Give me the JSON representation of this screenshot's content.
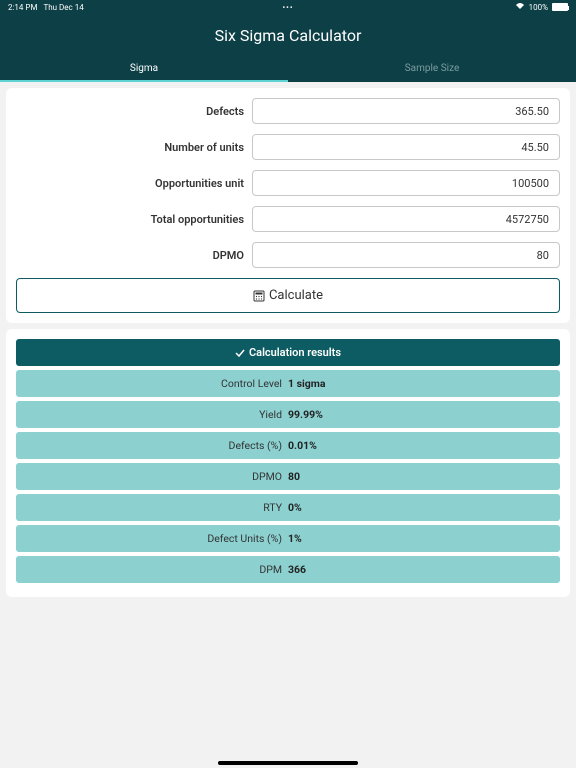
{
  "statusBar": {
    "time": "2:14 PM",
    "date": "Thu Dec 14",
    "dots": "•••",
    "wifi": "▾",
    "battery": "100%"
  },
  "header": {
    "title": "Six Sigma Calculator"
  },
  "tabs": {
    "sigma": "Sigma",
    "sampleSize": "Sample Size"
  },
  "form": {
    "defects": {
      "label": "Defects",
      "value": "365.50"
    },
    "units": {
      "label": "Number of units",
      "value": "45.50"
    },
    "oppUnit": {
      "label": "Opportunities unit",
      "value": "100500"
    },
    "totalOpp": {
      "label": "Total opportunities",
      "value": "4572750"
    },
    "dpmo": {
      "label": "DPMO",
      "value": "80"
    }
  },
  "calculateButton": "Calculate",
  "results": {
    "header": "Calculation results",
    "items": [
      {
        "label": "Control Level",
        "value": "1 sigma"
      },
      {
        "label": "Yield",
        "value": "99.99%"
      },
      {
        "label": "Defects (%)",
        "value": "0.01%"
      },
      {
        "label": "DPMO",
        "value": "80"
      },
      {
        "label": "RTY",
        "value": "0%"
      },
      {
        "label": "Defect Units (%)",
        "value": "1%"
      },
      {
        "label": "DPM",
        "value": "366"
      }
    ]
  }
}
